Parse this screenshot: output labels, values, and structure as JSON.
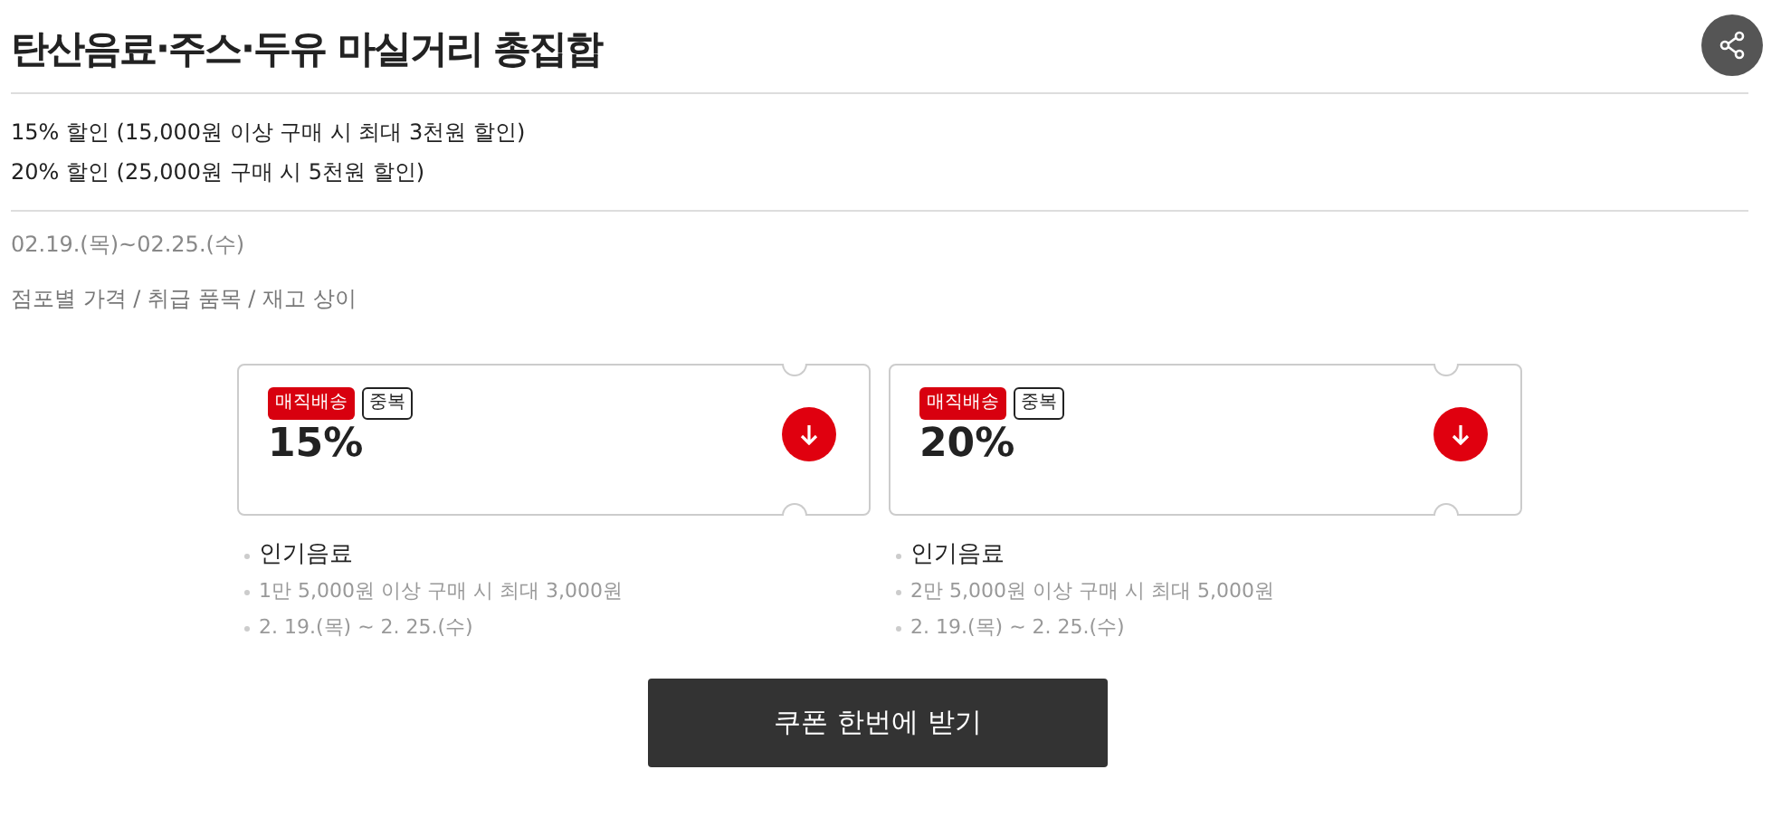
{
  "title": "탄산음료·주스·두유 마실거리 총집합",
  "discounts": [
    "15% 할인 (15,000원 이상 구매 시 최대 3천원 할인)",
    "20% 할인 (25,000원 구매 시 5천원 할인)"
  ],
  "period": "02.19.(목)~02.25.(수)",
  "note": "점포별 가격 / 취급 품목 / 재고 상이",
  "coupons": [
    {
      "badges": [
        {
          "label": "매직배송",
          "kind": "filled"
        },
        {
          "label": "중복",
          "kind": "outline"
        }
      ],
      "value": "15%",
      "category": "인기음료",
      "condition": "1만 5,000원 이상 구매 시 최대 3,000원",
      "dates": "2. 19.(목) ~ 2. 25.(수)"
    },
    {
      "badges": [
        {
          "label": "매직배송",
          "kind": "filled"
        },
        {
          "label": "중복",
          "kind": "outline"
        }
      ],
      "value": "20%",
      "category": "인기음료",
      "condition": "2만 5,000원 이상 구매 시 최대 5,000원",
      "dates": "2. 19.(목) ~ 2. 25.(수)"
    }
  ],
  "download_all_button": "쿠폰 한번에 받기"
}
